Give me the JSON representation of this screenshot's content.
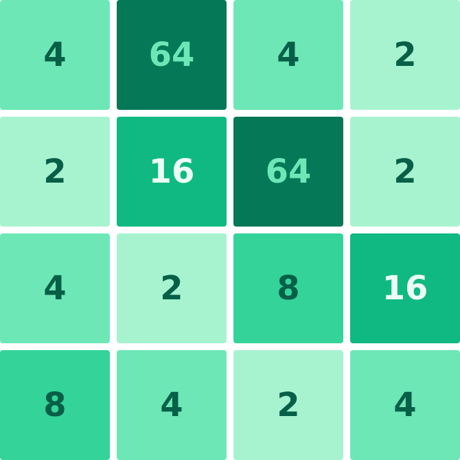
{
  "game": {
    "board": {
      "tiles": [
        {
          "value": "4",
          "bg": "#6ee7b7",
          "fg": "#065f46"
        },
        {
          "value": "64",
          "bg": "#047857",
          "fg": "#6ee7b7"
        },
        {
          "value": "4",
          "bg": "#6ee7b7",
          "fg": "#065f46"
        },
        {
          "value": "2",
          "bg": "#a7f3d0",
          "fg": "#065f46"
        },
        {
          "value": "2",
          "bg": "#a7f3d0",
          "fg": "#065f46"
        },
        {
          "value": "16",
          "bg": "#10b981",
          "fg": "#ecfdf5"
        },
        {
          "value": "64",
          "bg": "#047857",
          "fg": "#6ee7b7"
        },
        {
          "value": "2",
          "bg": "#a7f3d0",
          "fg": "#065f46"
        },
        {
          "value": "4",
          "bg": "#6ee7b7",
          "fg": "#065f46"
        },
        {
          "value": "2",
          "bg": "#a7f3d0",
          "fg": "#065f46"
        },
        {
          "value": "8",
          "bg": "#34d399",
          "fg": "#065f46"
        },
        {
          "value": "16",
          "bg": "#10b981",
          "fg": "#ecfdf5"
        },
        {
          "value": "8",
          "bg": "#34d399",
          "fg": "#065f46"
        },
        {
          "value": "4",
          "bg": "#6ee7b7",
          "fg": "#065f46"
        },
        {
          "value": "2",
          "bg": "#a7f3d0",
          "fg": "#065f46"
        },
        {
          "value": "4",
          "bg": "#6ee7b7",
          "fg": "#065f46"
        }
      ]
    }
  }
}
